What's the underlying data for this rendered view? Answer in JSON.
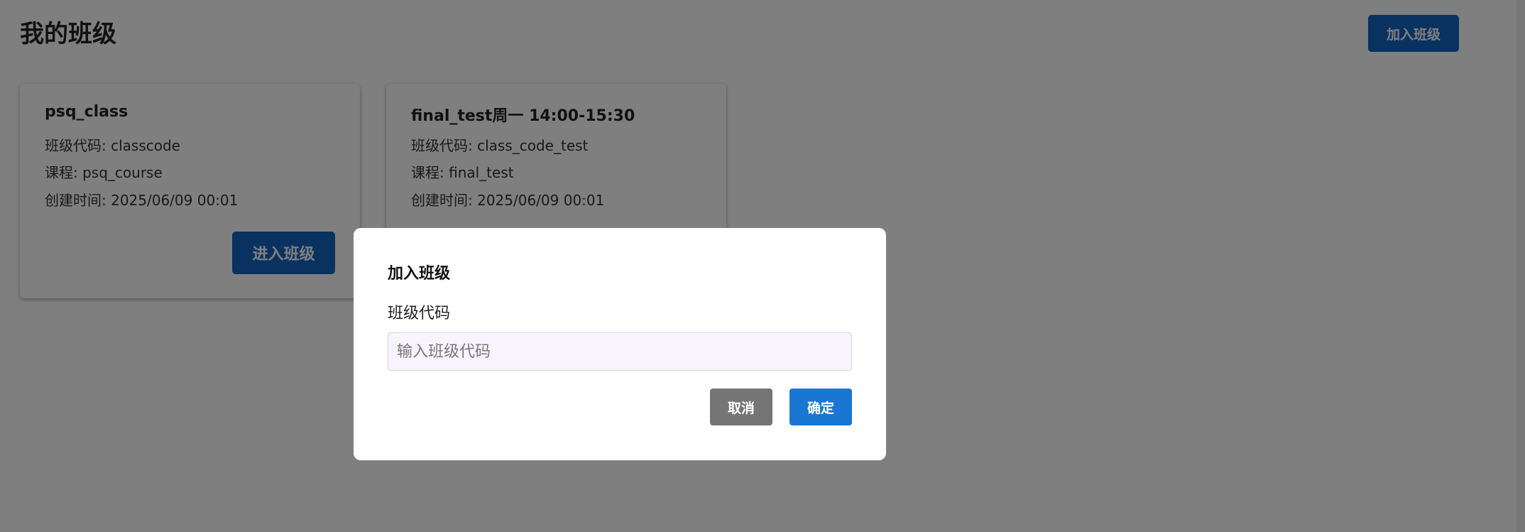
{
  "header": {
    "title": "我的班级",
    "join_button_label": "加入班级"
  },
  "classes": [
    {
      "name": "psq_class",
      "code_line": "班级代码: classcode",
      "course_line": "课程: psq_course",
      "created_line": "创建时间: 2025/06/09 00:01",
      "enter_label": "进入班级"
    },
    {
      "name": "final_test周一 14:00-15:30",
      "code_line": "班级代码: class_code_test",
      "course_line": "课程: final_test",
      "created_line": "创建时间: 2025/06/09 00:01"
    }
  ],
  "modal": {
    "title": "加入班级",
    "field_label": "班级代码",
    "input_value": "",
    "input_placeholder": "输入班级代码",
    "cancel_label": "取消",
    "confirm_label": "确定"
  },
  "colors": {
    "primary": "#1976d2",
    "primary_dark": "#1565c0",
    "cancel_gray": "#757575",
    "overlay": "rgba(0,0,0,0.5)"
  }
}
